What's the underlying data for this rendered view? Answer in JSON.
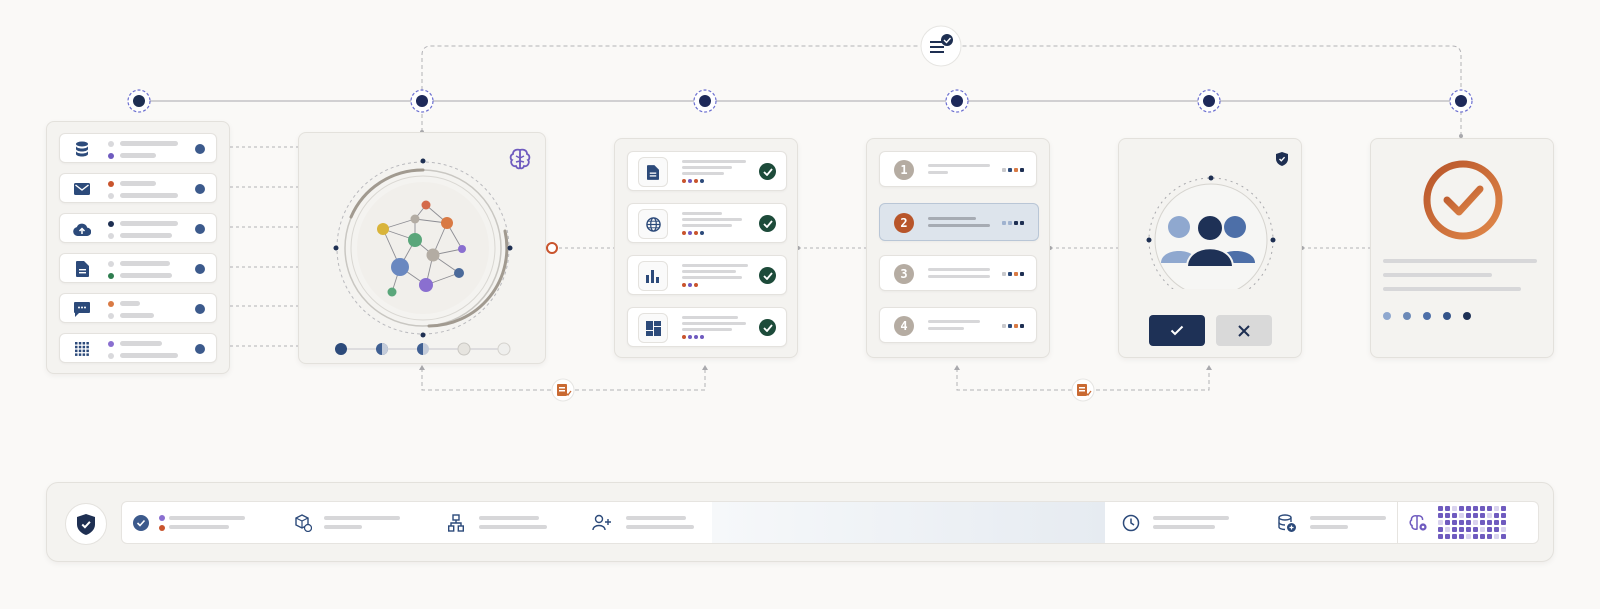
{
  "steps": [
    "1",
    "2",
    "3",
    "4"
  ],
  "colors": {
    "navy": "#1e2f52",
    "blue": "#3c5a8c",
    "orange": "#c96a33",
    "green": "#1d4b3a",
    "purple": "#6f5bbf",
    "gray": "#d7d7d9"
  },
  "icons": {
    "sources": [
      "database-icon",
      "mail-icon",
      "cloud-upload-icon",
      "document-icon",
      "chat-icon",
      "grid-icon"
    ],
    "checklist": [
      "document-icon",
      "globe-icon",
      "bar-chart-icon",
      "dashboard-icon"
    ],
    "footer": [
      "shield-check-icon",
      "check-circle-icon",
      "package-icon",
      "hierarchy-icon",
      "user-add-icon",
      "clock-icon",
      "database-add-icon",
      "brain-icon"
    ]
  }
}
